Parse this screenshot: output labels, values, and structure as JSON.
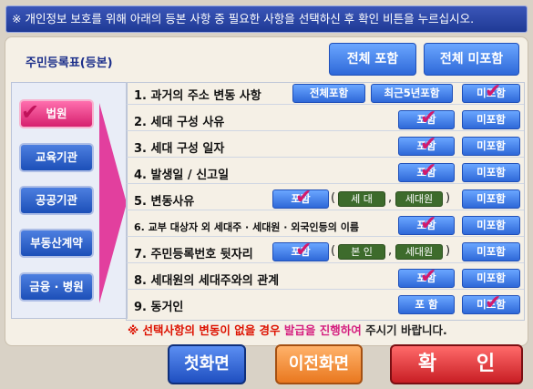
{
  "banner": "※ 개인정보 보호를 위해 아래의 등본 사항 중 필요한 사항을 선택하신 후 확인 비튼을 누르십시오.",
  "doc_title": "주민등록표(등본)",
  "top_buttons": {
    "include_all": "전체 포함",
    "exclude_all": "전체 미포함"
  },
  "sidebar": {
    "items": [
      "법원",
      "교육기관",
      "공공기관",
      "부동산계약",
      "금융 · 병원"
    ],
    "selected": "법원"
  },
  "rows": [
    {
      "label": "1. 과거의 주소 변동 사항",
      "opts": [
        "전체포함",
        "최근5년포함",
        "미포함"
      ],
      "checked": "미포함"
    },
    {
      "label": "2. 세대 구성 사유",
      "opts": [
        "포함",
        "미포함"
      ],
      "checked": "포함"
    },
    {
      "label": "3. 세대 구성 일자",
      "opts": [
        "포함",
        "미포함"
      ],
      "checked": "포함"
    },
    {
      "label": "4. 발생일 / 신고일",
      "opts": [
        "포함",
        "미포함"
      ],
      "checked": "포함"
    },
    {
      "label": "5. 변동사유",
      "opts": [
        "포함",
        "미포함"
      ],
      "sub": [
        "세 대",
        "세대원"
      ],
      "checked": "포함"
    },
    {
      "label": "6. 교부 대상자 외 세대주 · 세대원 · 외국인등의 이름",
      "opts": [
        "포함",
        "미포함"
      ],
      "checked": "포함"
    },
    {
      "label": "7. 주민등록번호 뒷자리",
      "opts": [
        "포함",
        "미포함"
      ],
      "sub": [
        "본 인",
        "세대원"
      ],
      "checked": "포함"
    },
    {
      "label": "8. 세대원의 세대주와의 관계",
      "opts": [
        "포함",
        "미포함"
      ],
      "checked": "포함"
    },
    {
      "label": "9. 동거인",
      "opts": [
        "포 함",
        "미포함"
      ],
      "checked": "미포함"
    }
  ],
  "notice": {
    "prefix": "※ 선택사항의 변동이 없을 경우 ",
    "highlight": "발급을 진행하여",
    "suffix": " 주시기 바랍니다."
  },
  "bottom": {
    "home": "첫화면",
    "prev": "이전화면",
    "ok": "확 인"
  },
  "colors": {
    "accent_blue": "#2e68d8",
    "selected_pink": "#d6206e",
    "check_mark": "#d21a6c",
    "ok_red": "#c81e24"
  }
}
